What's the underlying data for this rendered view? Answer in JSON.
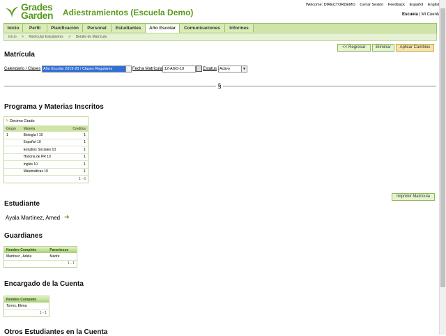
{
  "header": {
    "logo_line1": "Grades",
    "logo_line2": "Garden",
    "app_title": "Adiestramientos (Escuela Demo)",
    "top_links": [
      "Welcome: DIRECTORDEMO",
      "Cerrar Sesión",
      "Feedback",
      "Español",
      "English"
    ],
    "school_link": "Escuela",
    "account_link": "Mi Cuenta"
  },
  "nav": {
    "tabs": [
      "Inicio",
      "Perfil",
      "Planificación",
      "Personal",
      "Estudiantes",
      "Año Escolar",
      "Comunicaciones",
      "Informes"
    ],
    "active_tab": "Año Escolar"
  },
  "breadcrumb": [
    "Inicio",
    ">",
    "Matricular Estudiantes",
    ">",
    "Detalle de Matrícula"
  ],
  "toolbar": {
    "back_label": "<< Regresar",
    "delete_label": "Eliminar",
    "apply_label": "Aplicar Cambios"
  },
  "matricula": {
    "title": "Matrícula",
    "calendar_label": "Calendario / Clases",
    "calendar_value": "Año Escolar 2019-20 / Clases Regulares",
    "date_label": "Fecha Matrícula",
    "date_value": "12-AGO-19",
    "status_label": "Estatus",
    "status_value": "Activo",
    "divider_symbol": "§"
  },
  "programa": {
    "title": "Programa y Materias Inscritos",
    "grade": "Decimo Grado",
    "columns": [
      "Grupo",
      "Materia",
      "Creditos"
    ],
    "rows": [
      [
        "1",
        "Biología I 10",
        "1"
      ],
      [
        "",
        "Español 10",
        "1"
      ],
      [
        "",
        "Estudios Sociales 10",
        "1"
      ],
      [
        "",
        "Historia de PR 10",
        "1"
      ],
      [
        "",
        "Inglés 10",
        "1"
      ],
      [
        "",
        "Matemáticas 10",
        "1"
      ]
    ],
    "pager": "1 - 6",
    "print_label": "Imprimir Matrícula"
  },
  "estudiante": {
    "title": "Estudiante",
    "name": "Ayala Martínez, Amed"
  },
  "guardianes": {
    "title": "Guardianes",
    "columns": [
      "Nombre Completo",
      "Parentesco"
    ],
    "rows": [
      [
        "Martínez , Adela",
        "Madre"
      ]
    ],
    "pager": "1 - 1"
  },
  "encargado": {
    "title": "Encargado de la Cuenta",
    "columns": [
      "Nombre Completo"
    ],
    "rows": [
      [
        "Torres, Elena"
      ]
    ],
    "pager": "1 - 1"
  },
  "otros": {
    "title": "Otros Estudiantes en la Cuenta"
  },
  "colors": {
    "brand_green": "#5a9a1e",
    "nav_bg": "#cfe5a8",
    "apply_button": "#f6e3a8"
  }
}
